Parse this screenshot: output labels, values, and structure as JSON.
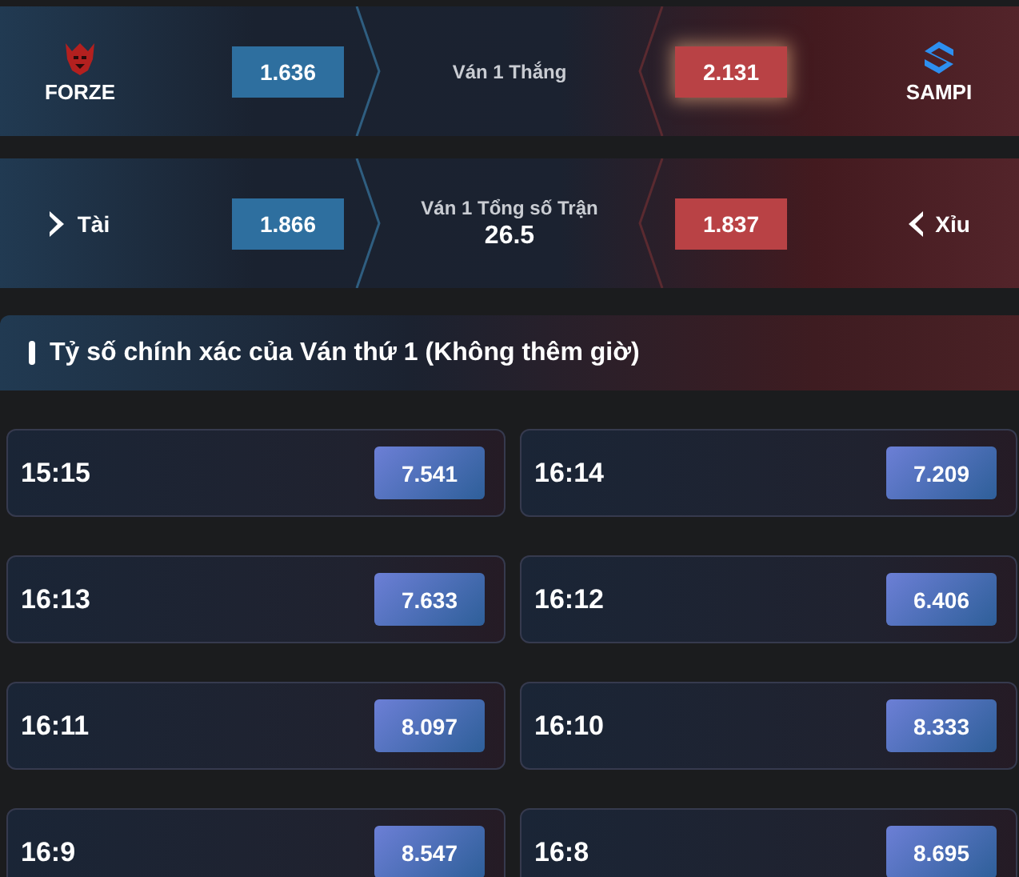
{
  "markets": [
    {
      "kind": "teams",
      "title": "Ván 1 Thắng",
      "left": {
        "name": "FORZE",
        "odds": "1.636",
        "selected": false
      },
      "right": {
        "name": "SAMPI",
        "odds": "2.131",
        "selected": true
      }
    },
    {
      "kind": "totals",
      "title": "Ván 1 Tổng số Trận",
      "line": "26.5",
      "left": {
        "name": "Tài",
        "odds": "1.866",
        "selected": false
      },
      "right": {
        "name": "Xỉu",
        "odds": "1.837",
        "selected": false
      }
    }
  ],
  "section": {
    "title": "Tỷ số chính xác của Ván thứ 1 (Không thêm giờ)"
  },
  "scores": [
    {
      "score": "15:15",
      "odds": "7.541"
    },
    {
      "score": "16:14",
      "odds": "7.209"
    },
    {
      "score": "16:13",
      "odds": "7.633"
    },
    {
      "score": "16:12",
      "odds": "6.406"
    },
    {
      "score": "16:11",
      "odds": "8.097"
    },
    {
      "score": "16:10",
      "odds": "8.333"
    },
    {
      "score": "16:9",
      "odds": "8.547"
    },
    {
      "score": "16:8",
      "odds": "8.695"
    }
  ]
}
